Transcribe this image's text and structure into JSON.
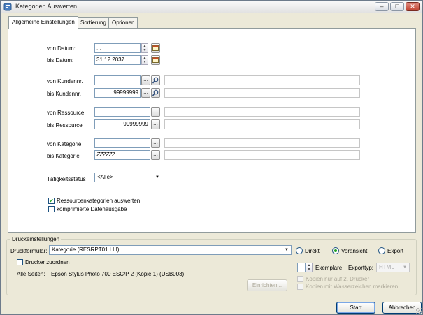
{
  "window": {
    "title": "Kategorien Auswerten"
  },
  "tabs": [
    {
      "label": "Allgemeine Einstellungen"
    },
    {
      "label": "Sortierung"
    },
    {
      "label": "Optionen"
    }
  ],
  "datum": {
    "von_label": "von Datum:",
    "von_value": ". .",
    "bis_label": "bis Datum:",
    "bis_value": "31.12.2037"
  },
  "kunden": {
    "von_label": "von Kundennr.",
    "von_value": "",
    "bis_label": "bis Kundennr.",
    "bis_value": "99999999"
  },
  "ressource": {
    "von_label": "von Ressource",
    "von_value": "",
    "bis_label": "bis Ressource",
    "bis_value": "99999999"
  },
  "kategorie": {
    "von_label": "von Kategorie",
    "von_value": "",
    "bis_label": "bis Kategorie",
    "bis_value": "ZZZZZZ"
  },
  "status": {
    "label": "Tätigkeitsstatus",
    "value": "<Alle>"
  },
  "options": [
    {
      "label": "Ressourcenkategorien auswerten",
      "checked": true
    },
    {
      "label": "komprimierte Datenausgabe",
      "checked": false
    }
  ],
  "browse_label": "...",
  "print": {
    "group_label": "Druckeinstellungen",
    "form_label": "Druckformular:",
    "form_value": "Kategorie (RESRPT01.LLI)",
    "mode_options": [
      {
        "label": "Direkt",
        "selected": false
      },
      {
        "label": "Voransicht",
        "selected": true
      },
      {
        "label": "Export",
        "selected": false
      }
    ],
    "assign_printer_label": "Drucker zuordnen",
    "pages_label": "Alle Seiten:",
    "printer_name": "Epson Stylus Photo 700 ESC/P 2 (Kopie 1) (USB003)",
    "setup_button": "Einrichten...",
    "copies_value": "",
    "copies_label": "Exemplare",
    "export_type_label": "Exporttyp:",
    "export_type_value": "HTML",
    "copies_second_printer": "Kopien nur auf 2. Drucker",
    "copies_watermark": "Kopien mit Wasserzeichen markieren"
  },
  "buttons": {
    "start": "Start",
    "cancel": "Abbrechen"
  }
}
